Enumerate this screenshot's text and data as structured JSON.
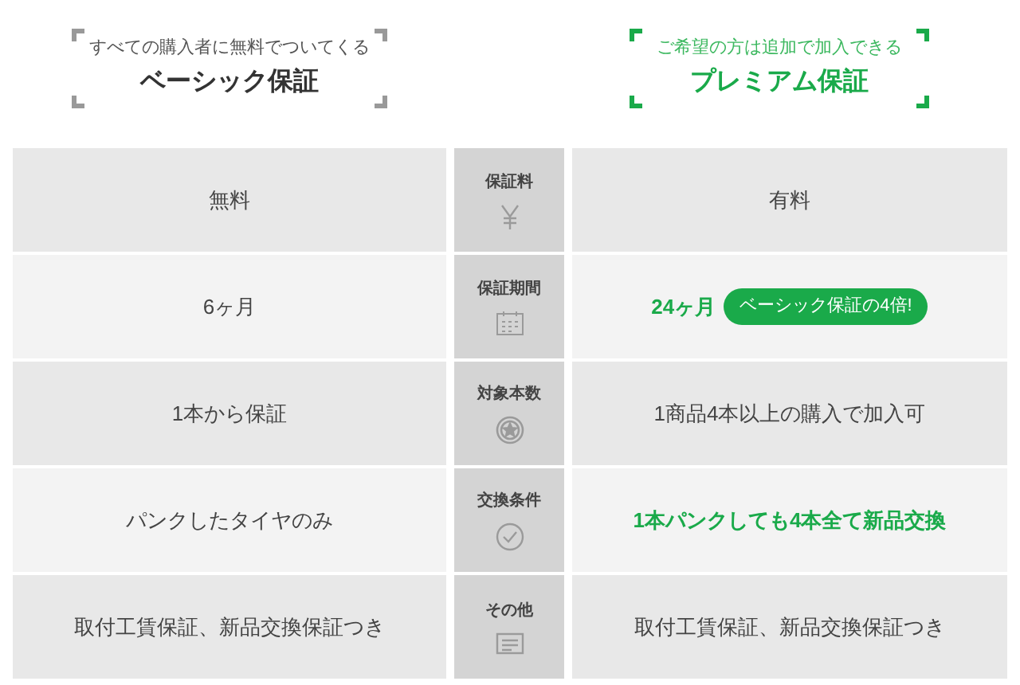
{
  "plans": [
    {
      "subtitle": "すべての購入者に無料でついてくる",
      "title": "ベーシック保証",
      "premium": false
    },
    {
      "subtitle": "ご希望の方は追加で加入できる",
      "title": "プレミアム保証",
      "premium": true
    }
  ],
  "rows": [
    {
      "basic": "無料",
      "label": "保証料",
      "premium": {
        "text": "有料",
        "emphasis": false
      }
    },
    {
      "basic": "6ヶ月",
      "label": "保証期間",
      "premium": {
        "text": "24ヶ月",
        "emphasis": true,
        "badge": "ベーシック保証の4倍!"
      }
    },
    {
      "basic": "1本から保証",
      "label": "対象本数",
      "premium": {
        "text": "1商品4本以上の購入で加入可",
        "emphasis": false
      }
    },
    {
      "basic": "パンクしたタイヤのみ",
      "label": "交換条件",
      "premium": {
        "text": "1本パンクしても4本全て新品交換",
        "emphasis": true
      }
    },
    {
      "basic": "取付工賃保証、新品交換保証つき",
      "label": "その他",
      "premium": {
        "text": "取付工賃保証、新品交換保証つき",
        "emphasis": false
      }
    }
  ]
}
